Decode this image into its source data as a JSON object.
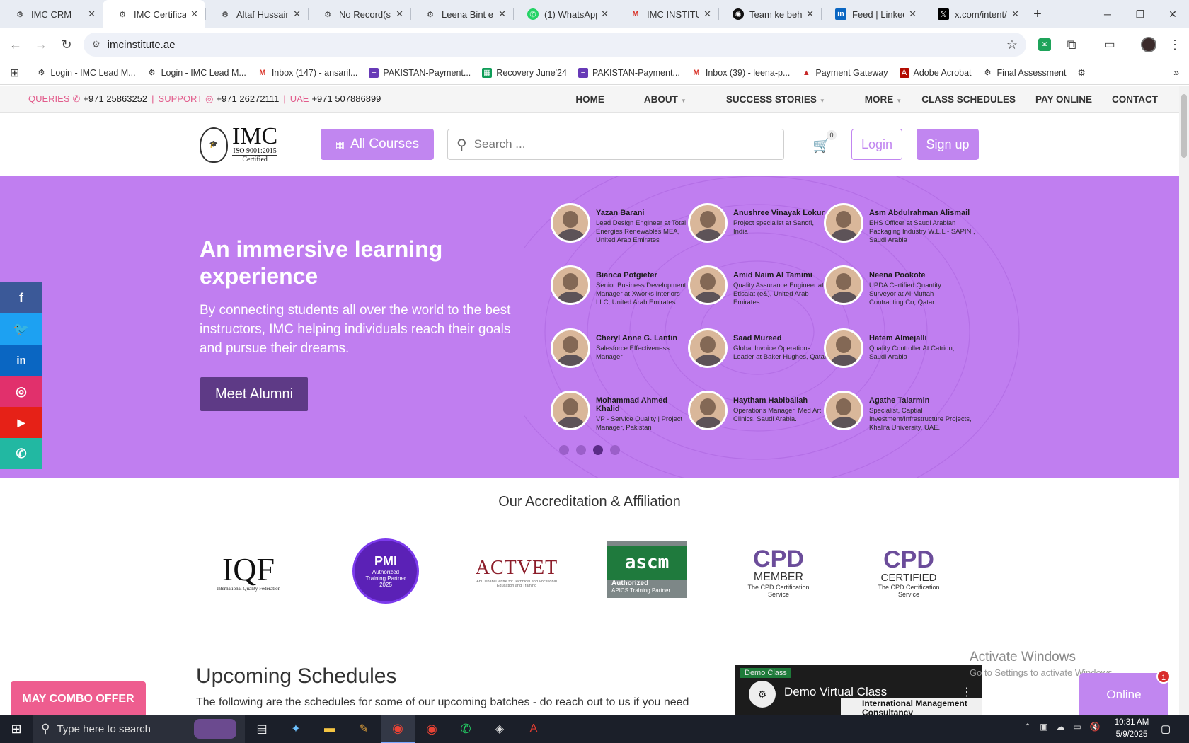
{
  "browser": {
    "tabs": [
      {
        "title": "IMC CRM",
        "icon": "imc-favicon"
      },
      {
        "title": "IMC Certificat",
        "icon": "imc-favicon",
        "active": true
      },
      {
        "title": "Altaf Hussain",
        "icon": "imc-favicon"
      },
      {
        "title": "No Record(s)",
        "icon": "imc-favicon"
      },
      {
        "title": "Leena Bint e T",
        "icon": "imc-favicon"
      },
      {
        "title": "(1) WhatsApp",
        "icon": "whatsapp-icon"
      },
      {
        "title": "IMC INSTITUT",
        "icon": "gmail-icon"
      },
      {
        "title": "Team ke beha",
        "icon": "chatgpt-icon"
      },
      {
        "title": "Feed | Linked",
        "icon": "linkedin-icon"
      },
      {
        "title": "x.com/intent/",
        "icon": "x-icon"
      }
    ],
    "url": "imcinstitute.ae",
    "bookmarks": [
      {
        "label": "Login - IMC Lead M...",
        "icon": "imc-favicon"
      },
      {
        "label": "Login - IMC Lead M...",
        "icon": "imc-favicon"
      },
      {
        "label": "Inbox (147) - ansaril...",
        "icon": "gmail-icon"
      },
      {
        "label": "PAKISTAN-Payment...",
        "icon": "forms-icon"
      },
      {
        "label": "Recovery June'24",
        "icon": "sheets-icon"
      },
      {
        "label": "PAKISTAN-Payment...",
        "icon": "forms-icon"
      },
      {
        "label": "Inbox (39) - leena-p...",
        "icon": "gmail-icon"
      },
      {
        "label": "Payment Gateway",
        "icon": "gateway-icon"
      },
      {
        "label": "Adobe Acrobat",
        "icon": "acrobat-icon"
      },
      {
        "label": "Final Assessment",
        "icon": "imc-favicon"
      }
    ]
  },
  "site": {
    "contact": {
      "queries_label": "QUERIES",
      "queries_phone": "+971 25863252",
      "support_label": "SUPPORT",
      "support_phone": "+971 26272111",
      "uae_label": "UAE",
      "uae_phone": "+971 507886899"
    },
    "nav": [
      "HOME",
      "ABOUT",
      "SUCCESS STORIES",
      "MORE",
      "CLASS SCHEDULES",
      "PAY ONLINE",
      "CONTACT"
    ],
    "logo": {
      "text": "IMC",
      "sub1": "ISO 9001:2015",
      "sub2": "Certified"
    },
    "all_courses": "All Courses",
    "search_placeholder": "Search ...",
    "cart_count": "0",
    "login": "Login",
    "signup": "Sign up",
    "hero": {
      "title": "An immersive learning experience",
      "text": "By connecting students all over the world to the best instructors, IMC helping individuals reach their goals and pursue their dreams.",
      "button": "Meet Alumni",
      "slide_count": 4,
      "active_slide": 3,
      "alumni": [
        {
          "name": "Yazan Barani",
          "role": "Lead Design Engineer at Total Energies Renewables MEA, United Arab Emirates"
        },
        {
          "name": "Anushree Vinayak Lokur",
          "role": "Project specialist at Sanofi, India"
        },
        {
          "name": "Asm Abdulrahman Alismail",
          "role": "EHS Officer at Saudi Arabian Packaging Industry W.L.L - SAPIN , Saudi Arabia"
        },
        {
          "name": "Bianca Potgieter",
          "role": "Senior Business Development Manager at Xworks Interiors LLC, United Arab Emirates"
        },
        {
          "name": "Amid Naim Al Tamimi",
          "role": "Quality Assurance Engineer at Etisalat (e&), United Arab Emirates"
        },
        {
          "name": "Neena Pookote",
          "role": "UPDA Certified Quantity Surveyor at Al-Muftah Contracting Co, Qatar"
        },
        {
          "name": "Cheryl Anne G. Lantin",
          "role": "Salesforce Effectiveness Manager"
        },
        {
          "name": "Saad Mureed",
          "role": "Global Invoice Operations Leader at Baker Hughes, Qatar"
        },
        {
          "name": "Hatem Almejalli",
          "role": "Quality Controller At Catrion, Saudi Arabia"
        },
        {
          "name": "Mohammad Ahmed Khalid",
          "role": "VP - Service Quality | Project Manager, Pakistan"
        },
        {
          "name": "Haytham Habiballah",
          "role": "Operations Manager, Med Art Clinics, Saudi Arabia."
        },
        {
          "name": "Agathe Talarmin",
          "role": "Specialist, Captial Investment/Infrastructure Projects, Khalifa University, UAE."
        }
      ]
    },
    "accreditation_title": "Our Accreditation & Affiliation",
    "accreditations": {
      "iqf": {
        "mark": "IQF",
        "sub": "International Quality Federation"
      },
      "pmi": {
        "mark": "PMI",
        "sub1": "Authorized",
        "sub2": "Training Partner",
        "year": "2025"
      },
      "actvet": {
        "mark": "ACTVET",
        "sub": "Abu Dhabi Centre for Technical and Vocational Education and Training"
      },
      "ascm": {
        "mark": "ascm",
        "sub1": "Authorized",
        "sub2": "APICS Training Partner"
      },
      "cpd_member": {
        "mark": "CPD",
        "word": "MEMBER",
        "sub": "The CPD Certification Service"
      },
      "cpd_certified": {
        "mark": "CPD",
        "word": "CERTIFIED",
        "sub": "The CPD Certification Service"
      }
    },
    "schedules_title": "Upcoming Schedules",
    "schedules_text": "The following are the schedules for some of our upcoming batches - do reach out to us if you need",
    "combo_offer": "MAY COMBO OFFER",
    "demo": {
      "badge": "Demo Class",
      "title": "Demo Virtual Class",
      "channel": "International Management Consultancy"
    },
    "watermark": {
      "line1": "Activate Windows",
      "line2": "Go to Settings to activate Windows."
    },
    "chat": {
      "label": "Online",
      "badge": "1"
    },
    "social": [
      "facebook-icon",
      "twitter-icon",
      "linkedin-icon",
      "instagram-icon",
      "youtube-icon",
      "whatsapp-icon"
    ]
  },
  "taskbar": {
    "search_placeholder": "Type here to search",
    "time": "10:31 AM",
    "date": "5/9/2025"
  },
  "colors": {
    "accent": "#c186f0",
    "hero_bg": "#c07ef0",
    "dark_purple": "#5e3a86",
    "pink": "#e25c8c"
  }
}
